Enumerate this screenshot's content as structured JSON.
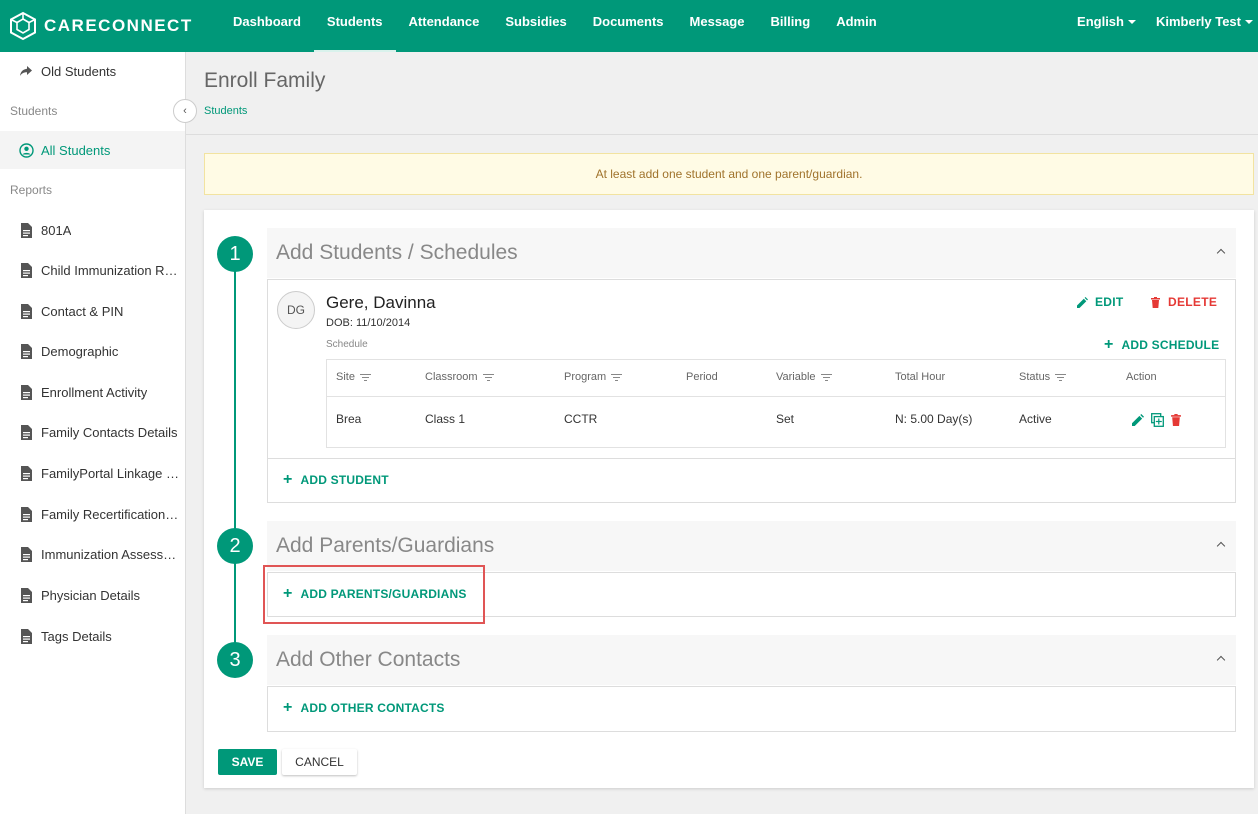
{
  "brand": {
    "name": "CARECONNECT",
    "color": "#009879"
  },
  "nav": {
    "items": [
      "Dashboard",
      "Students",
      "Attendance",
      "Subsidies",
      "Documents",
      "Message",
      "Billing",
      "Admin"
    ],
    "active": "Students",
    "language": "English",
    "user": "Kimberly Test"
  },
  "sidebar": {
    "old_students": "Old Students",
    "section_students": "Students",
    "all_students": "All Students",
    "section_reports": "Reports",
    "reports": [
      "801A",
      "Child Immunization Report",
      "Contact & PIN",
      "Demographic",
      "Enrollment Activity",
      "Family Contacts Details",
      "FamilyPortal Linkage Report",
      "Family Recertification Report",
      "Immunization Assessment",
      "Physician Details",
      "Tags Details"
    ]
  },
  "page": {
    "title": "Enroll Family",
    "breadcrumb": "Students",
    "alert": "At least add one student and one parent/guardian."
  },
  "steps": [
    {
      "number": "1",
      "title": "Add Students / Schedules"
    },
    {
      "number": "2",
      "title": "Add Parents/Guardians"
    },
    {
      "number": "3",
      "title": "Add Other Contacts"
    }
  ],
  "student": {
    "initials": "DG",
    "name": "Gere, Davinna",
    "dob": "DOB: 11/10/2014",
    "schedule_label": "Schedule",
    "edit_label": "EDIT",
    "delete_label": "DELETE",
    "add_schedule_label": "ADD SCHEDULE"
  },
  "schedule_table": {
    "headers": [
      "Site",
      "Classroom",
      "Program",
      "Period",
      "Variable",
      "Total Hour",
      "Status",
      "Action"
    ],
    "rows": [
      {
        "site": "Brea",
        "classroom": "Class 1",
        "program": "CCTR",
        "period": "",
        "variable": "Set",
        "total_hour": "N: 5.00 Day(s)",
        "status": "Active"
      }
    ]
  },
  "actions": {
    "add_student": "ADD STUDENT",
    "add_parents": "ADD PARENTS/GUARDIANS",
    "add_other_contacts": "ADD OTHER CONTACTS",
    "save": "SAVE",
    "cancel": "CANCEL"
  },
  "colors": {
    "primary": "#009879",
    "danger": "#e53935",
    "alert_bg": "#fffbe5"
  }
}
